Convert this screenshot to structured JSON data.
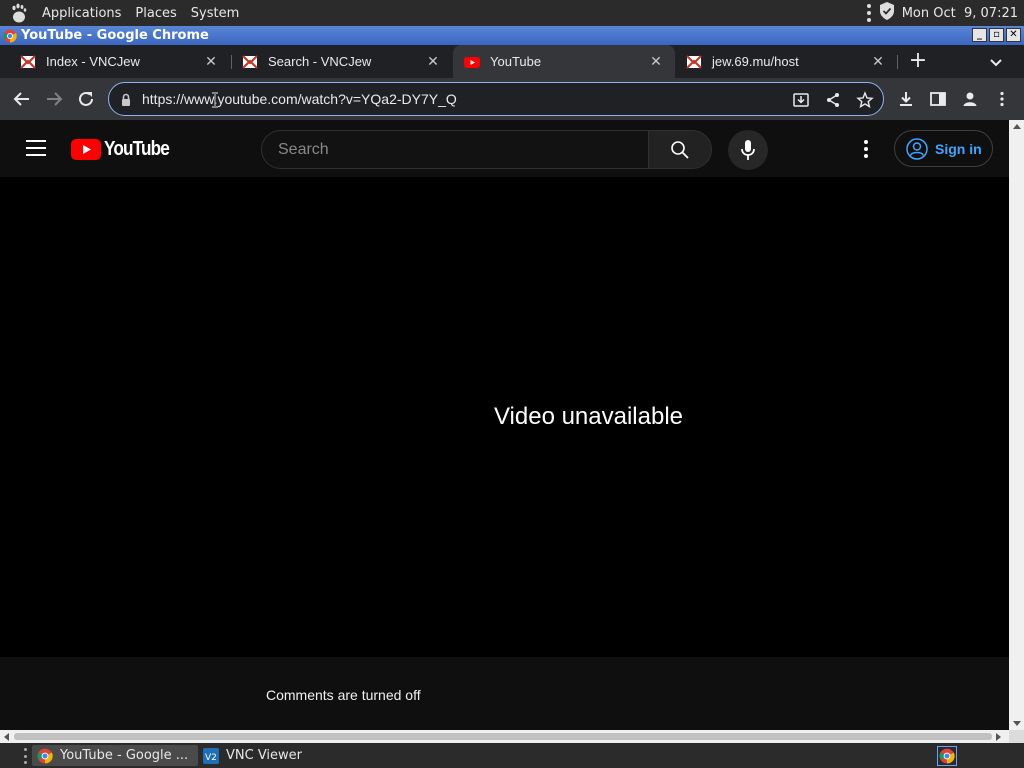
{
  "gnome_panel": {
    "menus": [
      "Applications",
      "Places",
      "System"
    ],
    "clock": "Mon Oct  9, 07:21"
  },
  "window": {
    "title": "YouTube - Google Chrome",
    "controls": [
      "minimize",
      "maximize",
      "close"
    ]
  },
  "tabs": [
    {
      "title": "Index - VNCJew",
      "favicon": "vncjew-icon",
      "active": false
    },
    {
      "title": "Search - VNCJew",
      "favicon": "vncjew-icon",
      "active": false
    },
    {
      "title": "YouTube",
      "favicon": "youtube-icon",
      "active": true
    },
    {
      "title": "jew.69.mu/host",
      "favicon": "vncjew-icon",
      "active": false
    }
  ],
  "address_bar": {
    "url": "https://www.youtube.com/watch?v=YQa2-DY7Y_Q"
  },
  "youtube": {
    "logo_text": "YouTube",
    "search_placeholder": "Search",
    "sign_in_label": "Sign in",
    "player_message": "Video unavailable",
    "comments_message": "Comments are turned off"
  },
  "taskbar": {
    "tasks": [
      {
        "label": "YouTube - Google ...",
        "icon": "chrome-icon",
        "active": true
      },
      {
        "label": "VNC Viewer",
        "icon": "vnc-viewer-icon",
        "active": false
      }
    ]
  },
  "colors": {
    "youtube_red": "#ff0000",
    "link_blue": "#3ea6ff",
    "title_bar_blue": "#3a66bf",
    "omnibox_focus": "#8ab4f8"
  }
}
